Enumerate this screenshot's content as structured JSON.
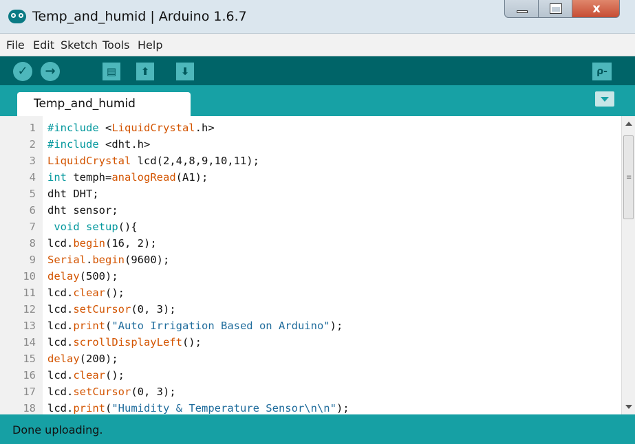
{
  "window": {
    "title": "Temp_and_humid | Arduino 1.6.7",
    "controls": {
      "minimize_icon": "minimize-icon",
      "maximize_icon": "maximize-icon",
      "close_glyph": "x"
    }
  },
  "menu": {
    "items": [
      "File",
      "Edit",
      "Sketch",
      "Tools",
      "Help"
    ]
  },
  "toolbar": {
    "buttons": [
      {
        "name": "verify",
        "icon": "checkmark-icon",
        "glyph": "✓"
      },
      {
        "name": "upload",
        "icon": "arrow-right-icon",
        "glyph": "→"
      },
      {
        "name": "new",
        "icon": "new-file-icon",
        "glyph": "▤"
      },
      {
        "name": "open",
        "icon": "arrow-up-icon",
        "glyph": "⬆"
      },
      {
        "name": "save",
        "icon": "arrow-down-icon",
        "glyph": "⬇"
      }
    ],
    "serial_monitor": {
      "icon": "serial-monitor-icon",
      "glyph": "ρ-"
    }
  },
  "tabs": {
    "active": "Temp_and_humid",
    "menu_icon": "tab-menu-icon"
  },
  "editor": {
    "lines": [
      {
        "n": "1",
        "text": "#include <LiquidCrystal.h>"
      },
      {
        "n": "2",
        "text": "#include <dht.h>"
      },
      {
        "n": "3",
        "text": "LiquidCrystal lcd(2,4,8,9,10,11);"
      },
      {
        "n": "4",
        "text": "int temph=analogRead(A1);"
      },
      {
        "n": "5",
        "text": "dht DHT;"
      },
      {
        "n": "6",
        "text": "dht sensor;"
      },
      {
        "n": "7",
        "text": " void setup(){"
      },
      {
        "n": "8",
        "text": "lcd.begin(16, 2);"
      },
      {
        "n": "9",
        "text": "Serial.begin(9600);"
      },
      {
        "n": "10",
        "text": "delay(500);"
      },
      {
        "n": "11",
        "text": "lcd.clear();"
      },
      {
        "n": "12",
        "text": "lcd.setCursor(0, 3);"
      },
      {
        "n": "13",
        "text": "lcd.print(\"Auto Irrigation Based on Arduino\");"
      },
      {
        "n": "14",
        "text": "lcd.scrollDisplayLeft();"
      },
      {
        "n": "15",
        "text": "delay(200);"
      },
      {
        "n": "16",
        "text": "lcd.clear();"
      },
      {
        "n": "17",
        "text": "lcd.setCursor(0, 3);"
      },
      {
        "n": "18",
        "text": "lcd.print(\"Humidity & Temperature Sensor\\n\\n\");"
      }
    ]
  },
  "status": {
    "message": "Done uploading."
  },
  "colors": {
    "toolbar_bg": "#006468",
    "tabbar_bg": "#17a1a5",
    "status_bg": "#16a0a4",
    "keyword_orange": "#d35400",
    "keyword_teal": "#00979c"
  }
}
